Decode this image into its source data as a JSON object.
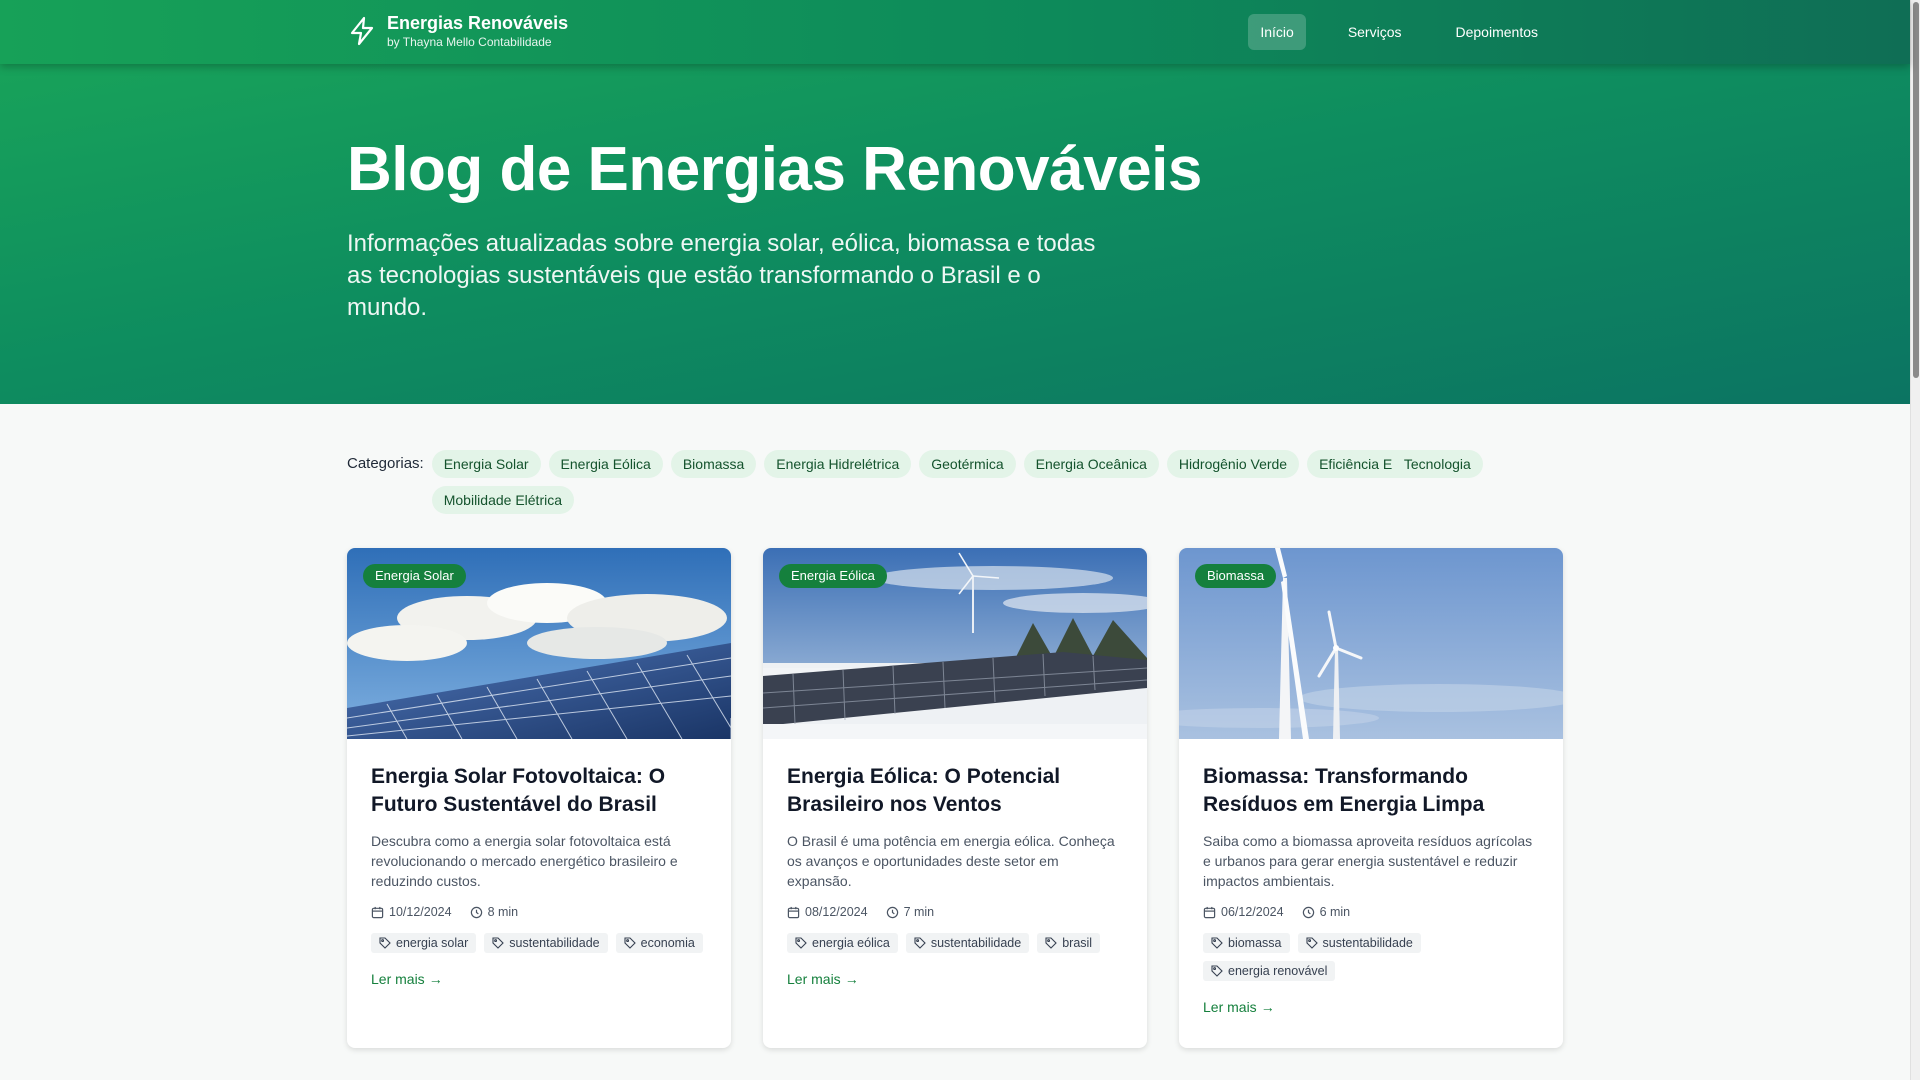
{
  "nav": {
    "brand_title": "Energias Renováveis",
    "brand_subtitle": "by Thayna Mello Contabilidade",
    "links": [
      {
        "label": "Início",
        "active": true
      },
      {
        "label": "Serviços",
        "active": false
      },
      {
        "label": "Depoimentos",
        "active": false
      }
    ]
  },
  "hero": {
    "title": "Blog de Energias Renováveis",
    "description": "Informações atualizadas sobre energia solar, eólica, biomassa e todas as tecnologias sustentáveis que estão transformando o Brasil e o mundo."
  },
  "categories": {
    "label": "Categorias:",
    "items": [
      "Energia Solar",
      "Energia Eólica",
      "Biomassa",
      "Energia Hidrelétrica",
      "Geotérmica",
      "Energia Oceânica",
      "Hidrogênio Verde",
      "Eficiência Energética",
      "Tecnologia",
      "Mobilidade Elétrica"
    ]
  },
  "posts": [
    {
      "badge": "Energia Solar",
      "title": "Energia Solar Fotovoltaica: O Futuro Sustentável do Brasil",
      "excerpt": "Descubra como a energia solar fotovoltaica está revolucionando o mercado energético brasileiro e reduzindo custos.",
      "date": "10/12/2024",
      "read_time": "8 min",
      "tags": [
        "energia solar",
        "sustentabilidade",
        "economia"
      ],
      "read_more": "Ler mais"
    },
    {
      "badge": "Energia Eólica",
      "title": "Energia Eólica: O Potencial Brasileiro nos Ventos",
      "excerpt": "O Brasil é uma potência em energia eólica. Conheça os avanços e oportunidades deste setor em expansão.",
      "date": "08/12/2024",
      "read_time": "7 min",
      "tags": [
        "energia eólica",
        "sustentabilidade",
        "brasil"
      ],
      "read_more": "Ler mais"
    },
    {
      "badge": "Biomassa",
      "title": "Biomassa: Transformando Resíduos em Energia Limpa",
      "excerpt": "Saiba como a biomassa aproveita resíduos agrícolas e urbanos para gerar energia sustentável e reduzir impactos ambientais.",
      "date": "06/12/2024",
      "read_time": "6 min",
      "tags": [
        "biomassa",
        "sustentabilidade",
        "energia renovável"
      ],
      "read_more": "Ler mais"
    }
  ],
  "colors": {
    "brand_green": "#15803d",
    "hero_start": "#18a25a",
    "hero_end": "#0c7462",
    "chip_bg": "#e3f4e8"
  }
}
